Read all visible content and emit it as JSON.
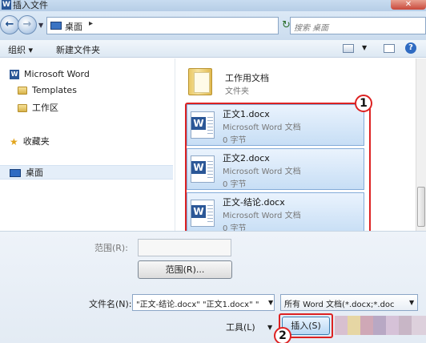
{
  "window": {
    "title": "插入文件",
    "close_label": "✕"
  },
  "navbar": {
    "back_icon": "arrow-left-icon",
    "address_path": "桌面",
    "address_separator": "▸",
    "search_placeholder": "搜索 桌面"
  },
  "toolbar": {
    "organize_label": "组织 ▾",
    "new_folder_label": "新建文件夹",
    "help_label": "?"
  },
  "sidebar": {
    "items": [
      {
        "label": "Microsoft Word",
        "icon": "word-icon"
      },
      {
        "label": "Templates",
        "icon": "folder-icon"
      },
      {
        "label": "工作区",
        "icon": "folder-icon"
      },
      {
        "label": "收藏夹",
        "icon": "star-icon"
      },
      {
        "label": "桌面",
        "icon": "desktop-icon",
        "selected": true
      }
    ]
  },
  "files": {
    "folder": {
      "name": "工作用文档",
      "type": "文件夹"
    },
    "items": [
      {
        "name": "正文1.docx",
        "type": "Microsoft Word 文档",
        "size": "0 字节",
        "selected": true
      },
      {
        "name": "正文2.docx",
        "type": "Microsoft Word 文档",
        "size": "0 字节",
        "selected": true
      },
      {
        "name": "正文-结论.docx",
        "type": "Microsoft Word 文档",
        "size": "0 字节",
        "selected": true
      }
    ]
  },
  "annotations": {
    "callout1": "1",
    "callout2": "2"
  },
  "bottom": {
    "range_label": "范围(R):",
    "range_button": "范围(R)...",
    "filename_label": "文件名(N):",
    "filename_value": "\"正文-结论.docx\" \"正文1.docx\" \"",
    "filetype_value": "所有 Word 文档(*.docx;*.doc",
    "tools_label": "工具(L)",
    "insert_label": "插入(S)"
  },
  "colors": {
    "selection_fill": "#c7def5",
    "annotation_red": "#dd2222",
    "accent": "#2b5797"
  }
}
